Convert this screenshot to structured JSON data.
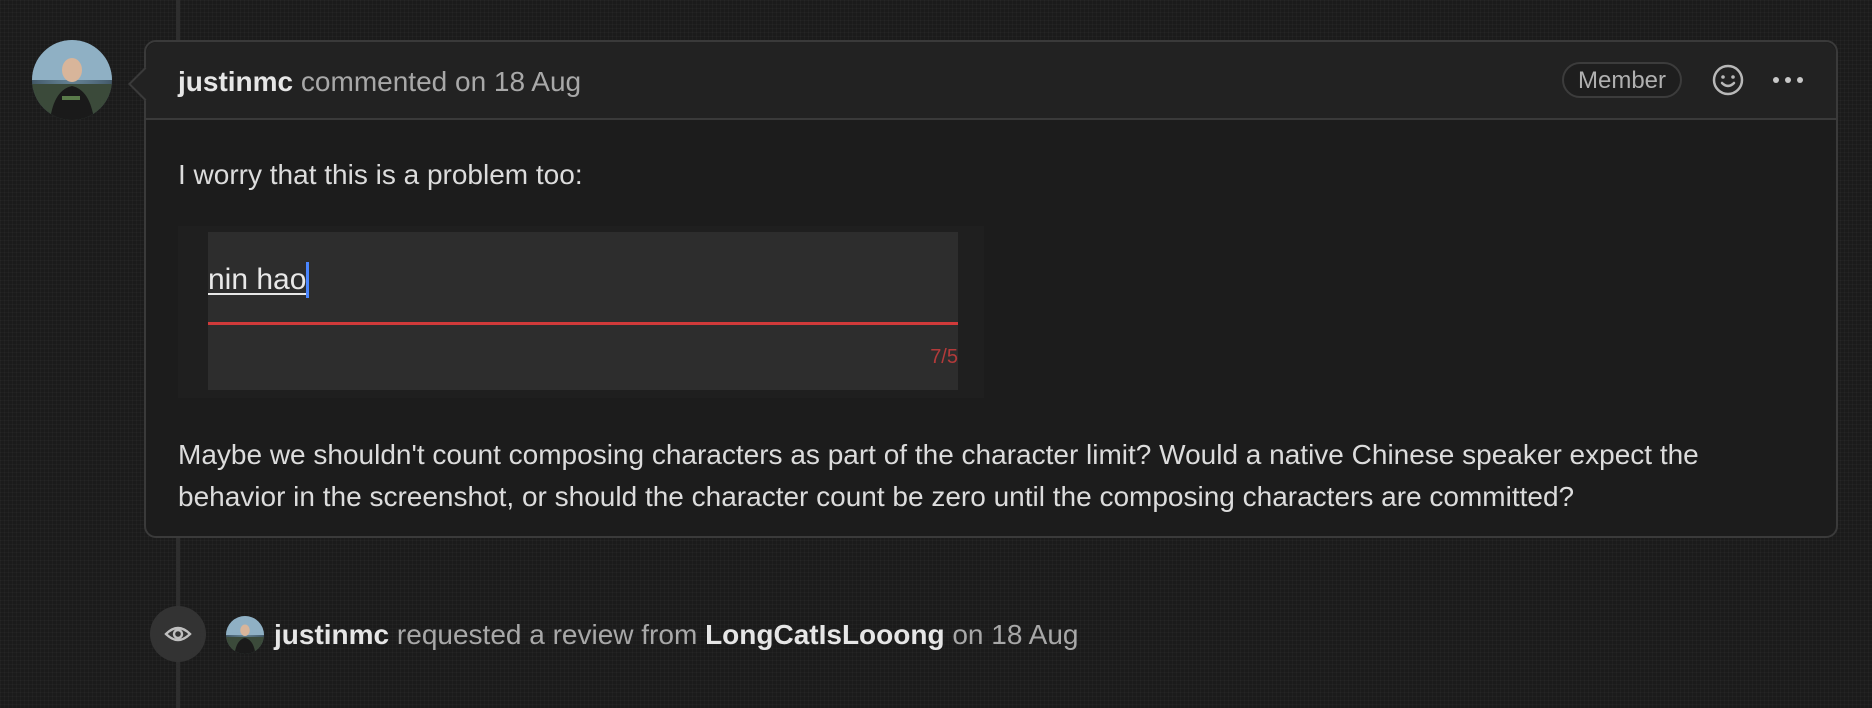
{
  "comment": {
    "author": "justinmc",
    "action": "commented on",
    "date": "18 Aug",
    "badge": "Member",
    "body_intro": "I worry that this is a problem too:",
    "embedded_screenshot": {
      "composing_text": "nin hao",
      "counter": "7/5",
      "error_color": "#d03a3a",
      "caret_color": "#4a86ff"
    },
    "body_question": "Maybe we shouldn't count composing characters as part of the character limit? Would a native Chinese speaker expect the behavior in the screenshot, or should the character count be zero until the composing characters are committed?"
  },
  "review_event": {
    "actor": "justinmc",
    "action": "requested a review from",
    "reviewer": "LongCatIsLooong",
    "date_prefix": "on",
    "date": "18 Aug"
  },
  "icons": {
    "emoji": "smiley-icon",
    "more": "kebab-horizontal-icon",
    "eye": "eye-icon"
  }
}
